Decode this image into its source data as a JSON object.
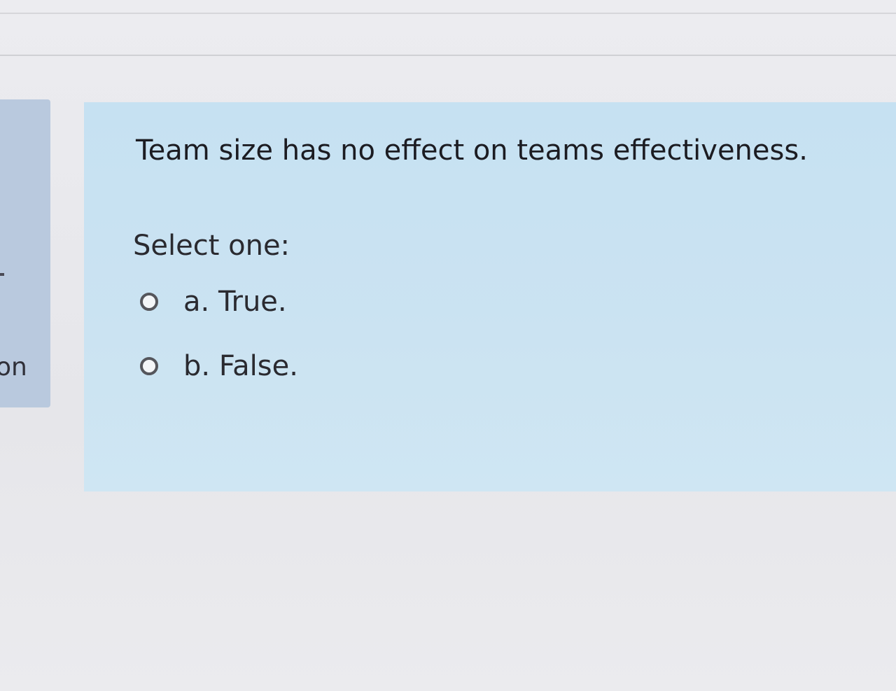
{
  "side_panel": {
    "label": "on"
  },
  "question": {
    "text": "Team size has no effect on teams effectiveness.",
    "prompt": "Select one:",
    "options": [
      {
        "letter": "a.",
        "label": "a. True."
      },
      {
        "letter": "b.",
        "label": "b. False."
      }
    ]
  },
  "colors": {
    "question_bg": "#c8e2f2",
    "side_panel_bg": "#b9c9de",
    "page_bg": "#e8e8ec",
    "text": "#1c1c22"
  }
}
